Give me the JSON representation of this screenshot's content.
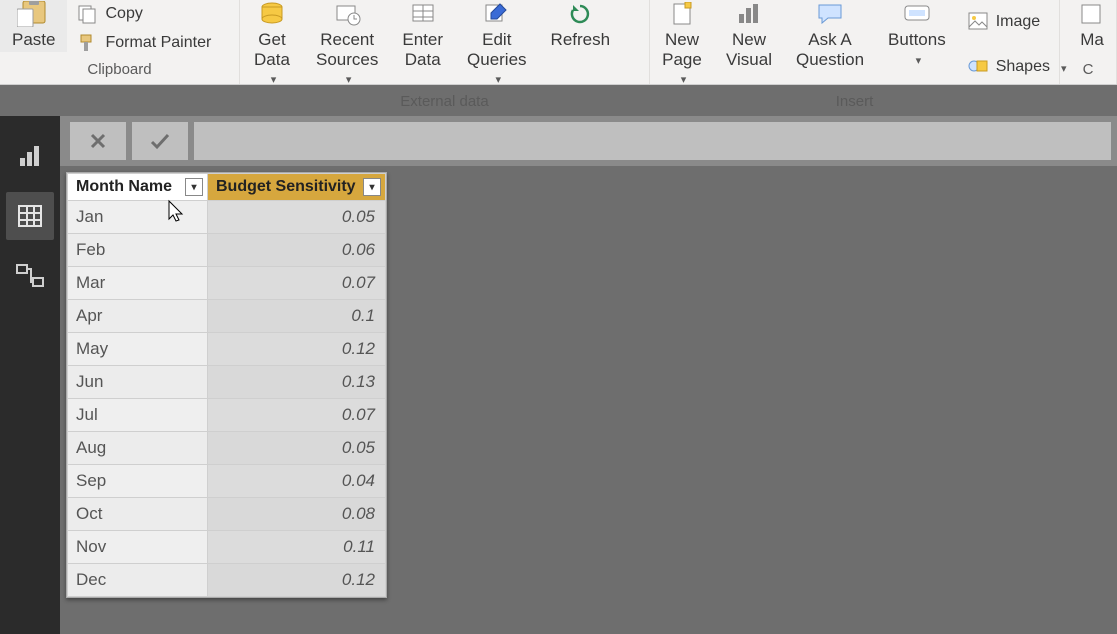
{
  "ribbon": {
    "clipboard": {
      "paste": "Paste",
      "copy": "Copy",
      "format_painter": "Format Painter",
      "group": "Clipboard"
    },
    "external": {
      "get_data": "Get\nData",
      "recent_sources": "Recent\nSources",
      "enter_data": "Enter\nData",
      "edit_queries": "Edit\nQueries",
      "refresh": "Refresh",
      "group": "External data"
    },
    "insert": {
      "new_page": "New\nPage",
      "new_visual": "New\nVisual",
      "ask_q": "Ask A\nQuestion",
      "buttons": "Buttons",
      "image": "Image",
      "shapes": "Shapes",
      "group": "Insert"
    },
    "partial": {
      "r1": "Ma"
    }
  },
  "table": {
    "col1": "Month Name",
    "col2": "Budget Sensitivity",
    "rows": [
      {
        "m": "Jan",
        "v": "0.05"
      },
      {
        "m": "Feb",
        "v": "0.06"
      },
      {
        "m": "Mar",
        "v": "0.07"
      },
      {
        "m": "Apr",
        "v": "0.1"
      },
      {
        "m": "May",
        "v": "0.12"
      },
      {
        "m": "Jun",
        "v": "0.13"
      },
      {
        "m": "Jul",
        "v": "0.07"
      },
      {
        "m": "Aug",
        "v": "0.05"
      },
      {
        "m": "Sep",
        "v": "0.04"
      },
      {
        "m": "Oct",
        "v": "0.08"
      },
      {
        "m": "Nov",
        "v": "0.11"
      },
      {
        "m": "Dec",
        "v": "0.12"
      }
    ]
  },
  "chart_data": {
    "type": "table",
    "title": "",
    "columns": [
      "Month Name",
      "Budget Sensitivity"
    ],
    "categories": [
      "Jan",
      "Feb",
      "Mar",
      "Apr",
      "May",
      "Jun",
      "Jul",
      "Aug",
      "Sep",
      "Oct",
      "Nov",
      "Dec"
    ],
    "values": [
      0.05,
      0.06,
      0.07,
      0.1,
      0.12,
      0.13,
      0.07,
      0.05,
      0.04,
      0.08,
      0.11,
      0.12
    ]
  },
  "colors": {
    "col2_header": "#d6a73e"
  }
}
